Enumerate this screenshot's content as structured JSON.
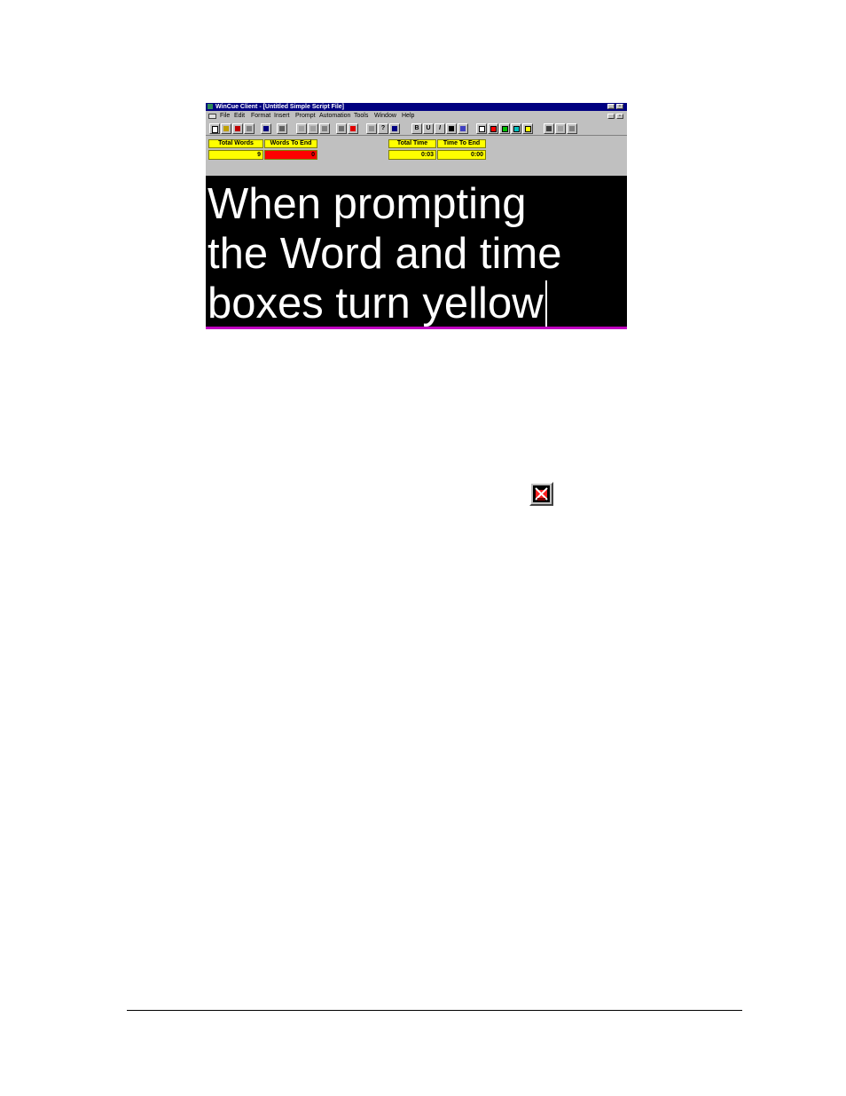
{
  "window": {
    "title": "WinCue Client - [Untitled Simple Script File]",
    "controls": {
      "minimize": "_",
      "restore": "▫",
      "doc_minimize": "_",
      "doc_restore": "▫"
    }
  },
  "menu": [
    "File",
    "Edit",
    "Format",
    "Insert",
    "Prompt",
    "Automation",
    "Tools",
    "Window",
    "Help"
  ],
  "toolbar": {
    "bold": "B",
    "underline": "U",
    "italic": "I",
    "help": "?",
    "color_swatches": [
      "#ffffff",
      "#ff0000",
      "#00c000",
      "#00c0c0",
      "#ffff00"
    ],
    "icons": [
      "new-file-icon",
      "open-file-icon",
      "open-folder-icon",
      "close-file-icon",
      "save-icon",
      "print-icon",
      "cut-icon",
      "copy-icon",
      "paste-icon",
      "find-icon",
      "stop-prompt-icon",
      "start-prompt-icon",
      "help-icon",
      "context-help-icon",
      "bold-icon",
      "underline-icon",
      "italic-icon",
      "font-color-icon",
      "text-style-icon",
      "align-left-icon",
      "align-center-icon",
      "align-right-icon"
    ]
  },
  "counters": {
    "total_words_label": "Total Words",
    "total_words_value": "9",
    "words_to_end_label": "Words To End",
    "words_to_end_value": "0",
    "total_time_label": "Total Time",
    "total_time_value": "0:03",
    "time_to_end_label": "Time To End",
    "time_to_end_value": "0:00",
    "colors": {
      "box": "#ffff00",
      "alert": "#ff0000"
    }
  },
  "script": {
    "lines": [
      "When prompting",
      "the Word and time",
      "boxes turn yellow"
    ],
    "background": "#000000",
    "text_color": "#ffffff"
  },
  "standalone_icon": "stop-prompt-icon"
}
